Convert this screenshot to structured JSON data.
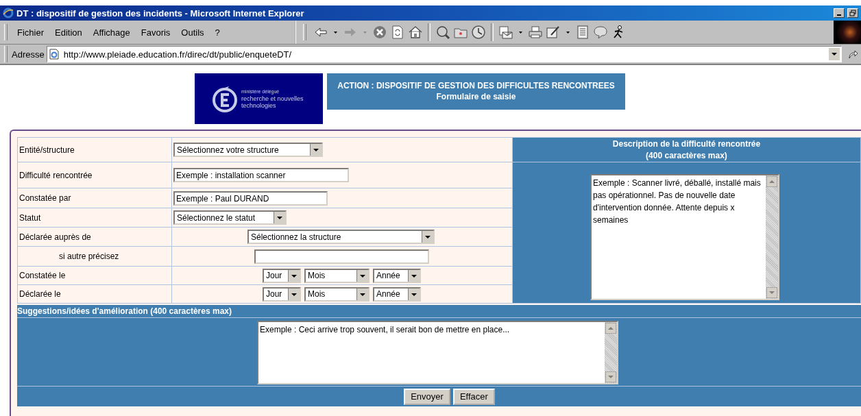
{
  "window": {
    "title": "DT : dispositif de gestion des incidents - Microsoft Internet Explorer"
  },
  "menu": [
    "Fichier",
    "Edition",
    "Affichage",
    "Favoris",
    "Outils",
    "?"
  ],
  "address": {
    "label": "Adresse",
    "url": "http://www.pleiade.education.fr/direc/dt/public/enqueteDT/"
  },
  "logo": {
    "lines": [
      "ministère délégué",
      "recherche et nouvelles",
      "technologies"
    ]
  },
  "header": {
    "title": "ACTION : DISPOSITIF DE GESTION DES DIFFICULTES RENCONTREES",
    "subtitle": "Formulaire de saisie"
  },
  "form": {
    "rows": [
      {
        "label": "Entité/structure",
        "kind": "select",
        "value": "Sélectionnez votre structure"
      },
      {
        "label": "Difficulté rencontrée",
        "kind": "input",
        "value": "Exemple :  installation scanner"
      },
      {
        "label": "Constatée par",
        "kind": "input",
        "value": "Exemple : Paul DURAND"
      },
      {
        "label": "Statut",
        "kind": "select",
        "value": "Sélectionnez le statut"
      },
      {
        "label": "Déclarée auprès de",
        "kind": "select",
        "value": "Sélectionnez la structure"
      },
      {
        "label": "si autre précisez",
        "kind": "input",
        "value": ""
      },
      {
        "label": "Constatée le",
        "kind": "date",
        "parts": [
          "Jour",
          "Mois",
          "Année"
        ]
      },
      {
        "label": "Déclarée le",
        "kind": "date",
        "parts": [
          "Jour",
          "Mois",
          "Année"
        ]
      }
    ],
    "description": {
      "title": "Description de la difficulté rencontrée",
      "subtitle": "(400 caractères max)",
      "value": "Exemple : Scanner livré, déballé, installé mais pas opérationnel. Pas de nouvelle date d'intervention donnée. Attente depuis x semaines"
    },
    "suggestions": {
      "title": "Suggestions/idées d'amélioration (400 caractères max)",
      "value": "Exemple :  Ceci arrive trop souvent, il serait bon de mettre en place..."
    },
    "buttons": [
      "Envoyer",
      "Effacer"
    ]
  }
}
